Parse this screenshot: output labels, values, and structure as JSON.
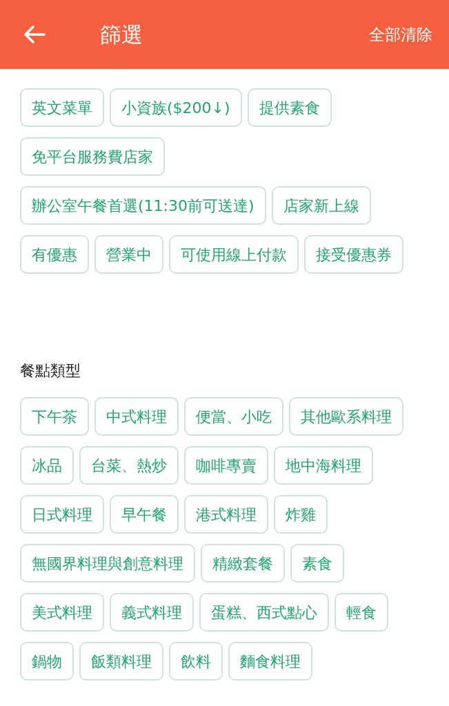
{
  "header": {
    "title": "篩選",
    "clear_all": "全部清除"
  },
  "sections": [
    {
      "chips": [
        {
          "label": "英文菜單",
          "selected": false
        },
        {
          "label": "小資族($200↓)",
          "selected": false
        },
        {
          "label": "提供素食",
          "selected": false
        },
        {
          "label": "免平台服務費店家",
          "selected": false
        },
        {
          "label": "辦公室午餐首選(11:30前可送達)",
          "selected": false
        },
        {
          "label": "店家新上線",
          "selected": false
        },
        {
          "label": "有優惠",
          "selected": false
        },
        {
          "label": "營業中",
          "selected": false
        },
        {
          "label": "可使用線上付款",
          "selected": false
        },
        {
          "label": "接受優惠券",
          "selected": false
        }
      ]
    },
    {
      "title": "餐點類型",
      "chips": [
        {
          "label": "下午茶",
          "selected": false
        },
        {
          "label": "中式料理",
          "selected": false
        },
        {
          "label": "便當、小吃",
          "selected": false
        },
        {
          "label": "其他歐系料理",
          "selected": false
        },
        {
          "label": "冰品",
          "selected": false
        },
        {
          "label": "台菜、熱炒",
          "selected": false
        },
        {
          "label": "咖啡專賣",
          "selected": false
        },
        {
          "label": "地中海料理",
          "selected": false
        },
        {
          "label": "日式料理",
          "selected": false
        },
        {
          "label": "早午餐",
          "selected": false
        },
        {
          "label": "港式料理",
          "selected": false
        },
        {
          "label": "炸雞",
          "selected": false
        },
        {
          "label": "無國界料理與創意料理",
          "selected": false
        },
        {
          "label": "精緻套餐",
          "selected": false
        },
        {
          "label": "素食",
          "selected": false
        },
        {
          "label": "美式料理",
          "selected": false
        },
        {
          "label": "義式料理",
          "selected": false
        },
        {
          "label": "蛋糕、西式點心",
          "selected": false
        },
        {
          "label": "輕食",
          "selected": false
        },
        {
          "label": "鍋物",
          "selected": false
        },
        {
          "label": "飯類料理",
          "selected": false
        },
        {
          "label": "飲料",
          "selected": false
        },
        {
          "label": "麵食料理",
          "selected": false
        }
      ]
    }
  ]
}
